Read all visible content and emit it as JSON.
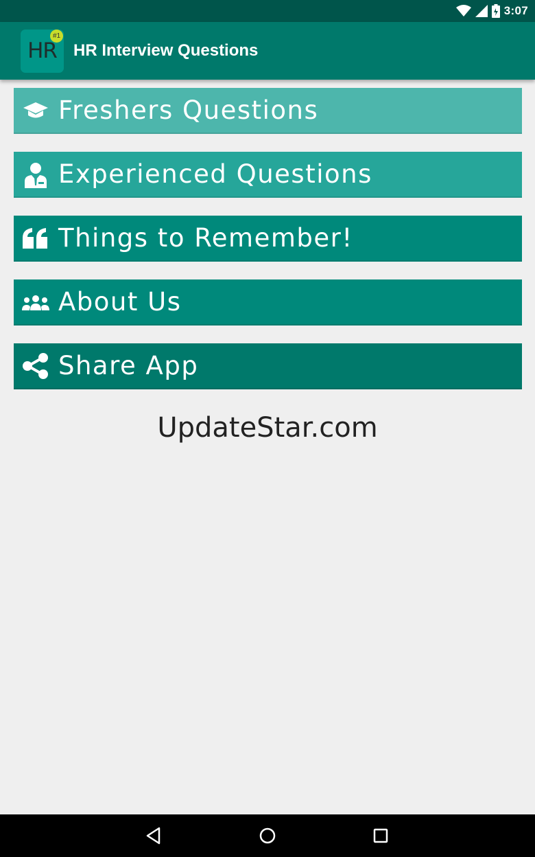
{
  "status_bar": {
    "time": "3:07",
    "icons": [
      "wifi-icon",
      "cell-signal-icon",
      "battery-icon"
    ]
  },
  "app_bar": {
    "logo_text": "HR",
    "logo_badge": "#1",
    "title": "HR Interview Questions"
  },
  "menu": {
    "items": [
      {
        "label": "Freshers Questions",
        "icon": "graduation-cap-icon",
        "color": "#4db6ac"
      },
      {
        "label": "Experienced Questions",
        "icon": "user-tie-icon",
        "color": "#26a69a"
      },
      {
        "label": "Things to Remember!",
        "icon": "quote-icon",
        "color": "#00897b"
      },
      {
        "label": "About Us",
        "icon": "users-icon",
        "color": "#00897b"
      },
      {
        "label": "Share App",
        "icon": "share-icon",
        "color": "#00796b"
      }
    ]
  },
  "watermark": "UpdateStar.com",
  "nav_bar": {
    "buttons": [
      "back-icon",
      "home-icon",
      "recents-icon"
    ]
  },
  "colors": {
    "status_bar": "#00554b",
    "app_bar": "#00796b",
    "background": "#efefef"
  }
}
